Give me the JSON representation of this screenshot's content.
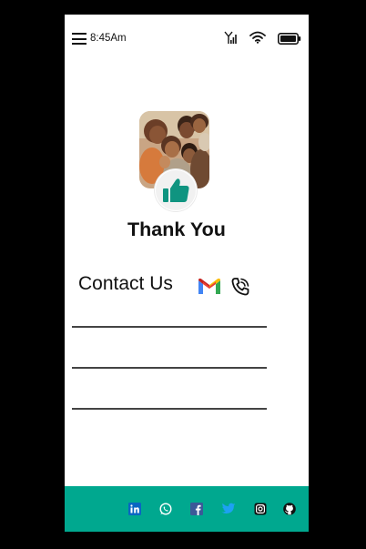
{
  "status_bar": {
    "time": "8:45Am",
    "icons": [
      "menu-icon",
      "signal-icon",
      "wifi-icon",
      "battery-icon"
    ]
  },
  "main": {
    "hero_image": "family-group-hug-photo",
    "badge_icon": "thumbs-up-icon",
    "heading": "Thank You"
  },
  "contact": {
    "label": "Contact Us",
    "icons": [
      "gmail-icon",
      "phone-call-icon"
    ],
    "field_count": 3
  },
  "footer": {
    "social_icons": [
      "linkedin-icon",
      "whatsapp-icon",
      "facebook-icon",
      "twitter-icon",
      "instagram-icon",
      "github-icon"
    ]
  },
  "colors": {
    "accent": "#00A88F",
    "background": "#ffffff",
    "frame": "#000000"
  }
}
